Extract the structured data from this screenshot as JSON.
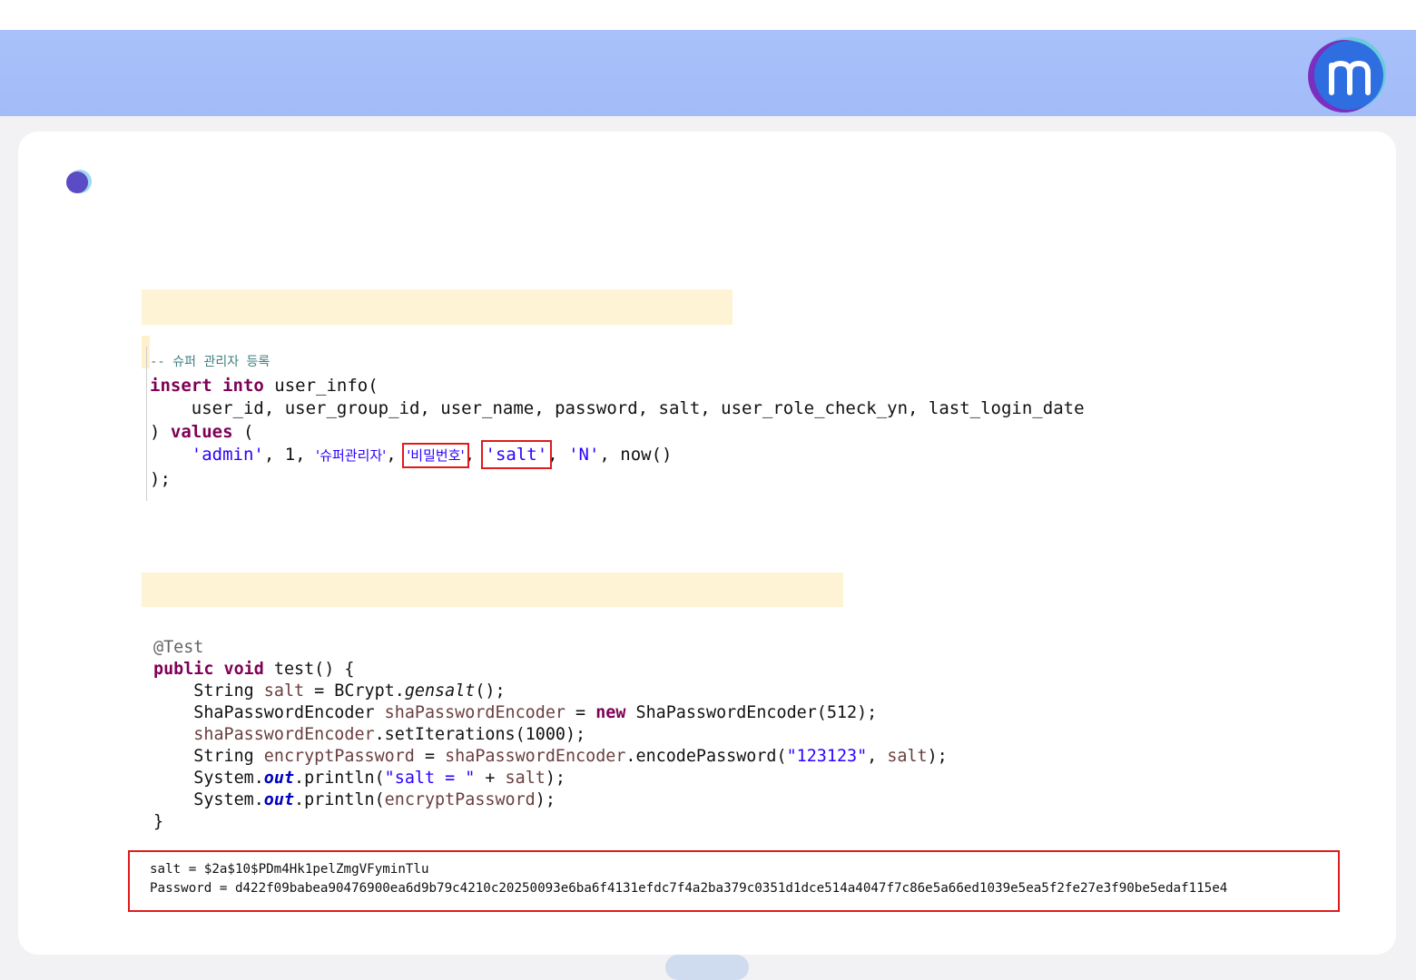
{
  "brand": {
    "logo_letter": "m",
    "logo_colors": [
      "#7b2fbf",
      "#2e6ee0",
      "#3ad6c4"
    ],
    "bullet_colors": [
      "#5b4bc4",
      "#9fd8f4"
    ]
  },
  "sql_block": {
    "comment": "-- 슈퍼 관리자 등록",
    "kw_insert": "insert",
    "kw_into": "into",
    "table_open": " user_info(",
    "columns_line": "    user_id, user_group_id, user_name, password, salt, user_role_check_yn, last_login_date",
    "close_paren": ") ",
    "kw_values": "values",
    "values_open": " (",
    "val_admin": "'admin'",
    "val_one": ", 1, ",
    "val_superadmin": "'슈퍼관리자'",
    "comma": ", ",
    "val_password": "'비밀번호'",
    "val_salt": "'salt'",
    "val_n": "'N'",
    "val_now": ", now()",
    "end": ");"
  },
  "java_block": {
    "annotation": "@Test",
    "kw_public": "public",
    "kw_void": "void",
    "sig": " test() {",
    "line_salt_type": "    String ",
    "var_salt": "salt",
    "line_salt_rest": " = BCrypt.",
    "method_gensalt": "gensalt",
    "line_salt_end": "();",
    "line_enc_type": "    ShaPasswordEncoder ",
    "var_encoder": "shaPasswordEncoder",
    "line_enc_mid": " = ",
    "kw_new": "new",
    "line_enc_end": " ShaPasswordEncoder(512);",
    "line_iter_indent": "    ",
    "line_iter_end": ".setIterations(1000);",
    "line_pw_type": "    String ",
    "var_encrypt": "encryptPassword",
    "line_pw_mid": ".encodePassword(",
    "str_123123": "\"123123\"",
    "line_pw_end": ");",
    "sys": "    System.",
    "fld_out": "out",
    "println_open": ".println(",
    "str_salt_eq": "\"salt = \"",
    "plus": " + ",
    "println_close": ");",
    "close_brace": "}"
  },
  "output": {
    "line1": "salt = $2a$10$PDm4Hk1pelZmgVFyminTlu",
    "line2": "Password = d422f09babea90476900ea6d9b79c4210c20250093e6ba6f4131efdc7f4a2ba379c0351d1dce514a4047f7c86e5a66ed1039e5ea5f2fe27e3f90be5edaf115e4"
  }
}
